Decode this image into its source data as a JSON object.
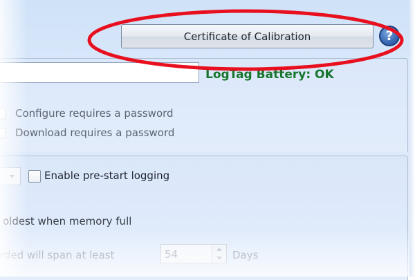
{
  "header": {
    "certificate_button_label": "Certificate of Calibration",
    "help_icon_glyph": "?"
  },
  "status": {
    "battery_text": "LogTag Battery: OK",
    "battery_color": "#17752c"
  },
  "security": {
    "configure_password_label": "Configure requires a password",
    "download_password_label": "Download requires a password"
  },
  "logging": {
    "pre_start_label": "Enable pre-start logging",
    "overwrite_label": "oldest when memory full",
    "span_label": "rded will span at least",
    "span_value": "54",
    "span_unit": "Days"
  },
  "annotation": {
    "highlight_color": "#e8101e"
  }
}
